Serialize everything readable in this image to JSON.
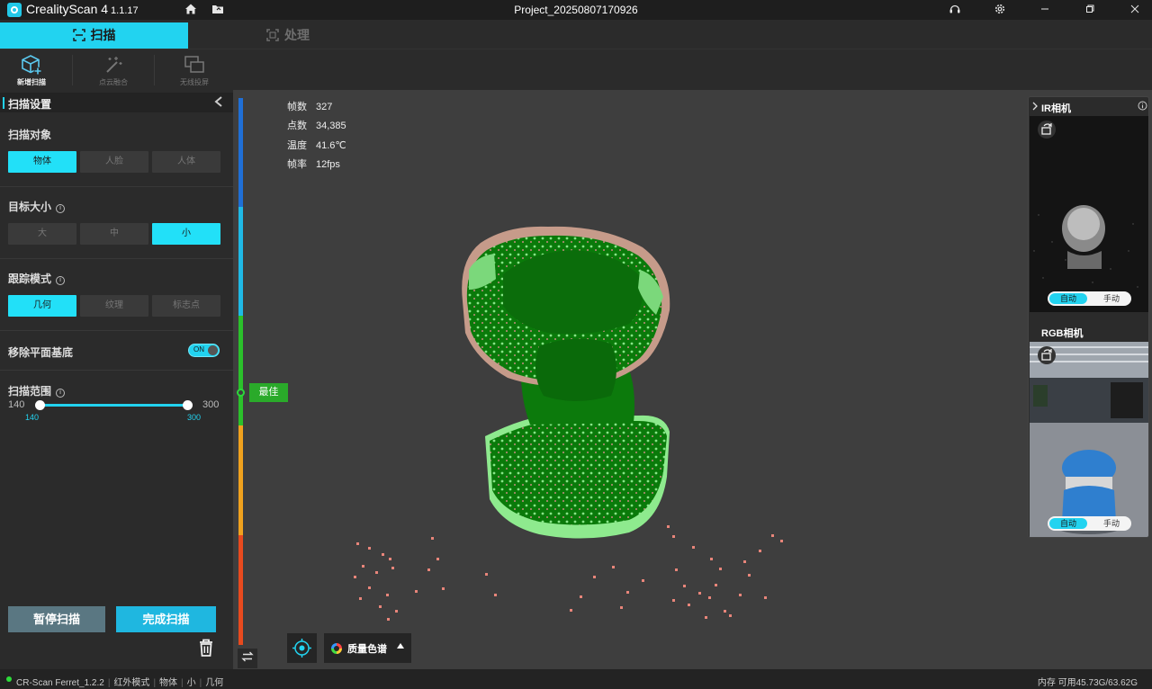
{
  "titlebar": {
    "app_name": "CrealityScan 4",
    "app_version": "1.1.17",
    "project_name": "Project_20250807170926"
  },
  "mode_tabs": {
    "scan": "扫描",
    "process": "处理"
  },
  "toolbar": {
    "new_scan": "新增扫描",
    "point_fusion": "点云融合",
    "wireless_cast": "无线投屏"
  },
  "left_panel": {
    "header": "扫描设置",
    "scan_object": {
      "title": "扫描对象",
      "options": [
        "物体",
        "人脸",
        "人体"
      ],
      "selected": "物体"
    },
    "target_size": {
      "title": "目标大小",
      "options": [
        "大",
        "中",
        "小"
      ],
      "selected": "小"
    },
    "tracking_mode": {
      "title": "跟踪模式",
      "options": [
        "几何",
        "纹理",
        "标志点"
      ],
      "selected": "几何"
    },
    "remove_plane": {
      "label": "移除平面基底",
      "state": "ON"
    },
    "scan_range": {
      "title": "扫描范围",
      "min_label": "140",
      "max_label": "300",
      "low_value": "140",
      "high_value": "300"
    },
    "pause_button": "暂停扫描",
    "finish_button": "完成扫描"
  },
  "viewport": {
    "stats": [
      {
        "key": "帧数",
        "value": "327"
      },
      {
        "key": "点数",
        "value": "34,385"
      },
      {
        "key": "温度",
        "value": "41.6℃"
      },
      {
        "key": "帧率",
        "value": "12fps"
      }
    ],
    "distance_label": "最佳",
    "colormap_label": "质量色谱"
  },
  "camera_panel": {
    "ir_title": "IR相机",
    "rgb_title": "RGB相机",
    "auto_label": "自动",
    "manual_label": "手动"
  },
  "statusbar": {
    "items": [
      "CR-Scan Ferret_1.2.2",
      "红外模式",
      "物体",
      "小",
      "几何"
    ],
    "memory": "内存 可用45.73G/63.62G"
  },
  "colors": {
    "accent": "#22d3f0",
    "best_green": "#2aaa2a",
    "background": "#3e3e3e",
    "panel": "#2b2b2b"
  }
}
